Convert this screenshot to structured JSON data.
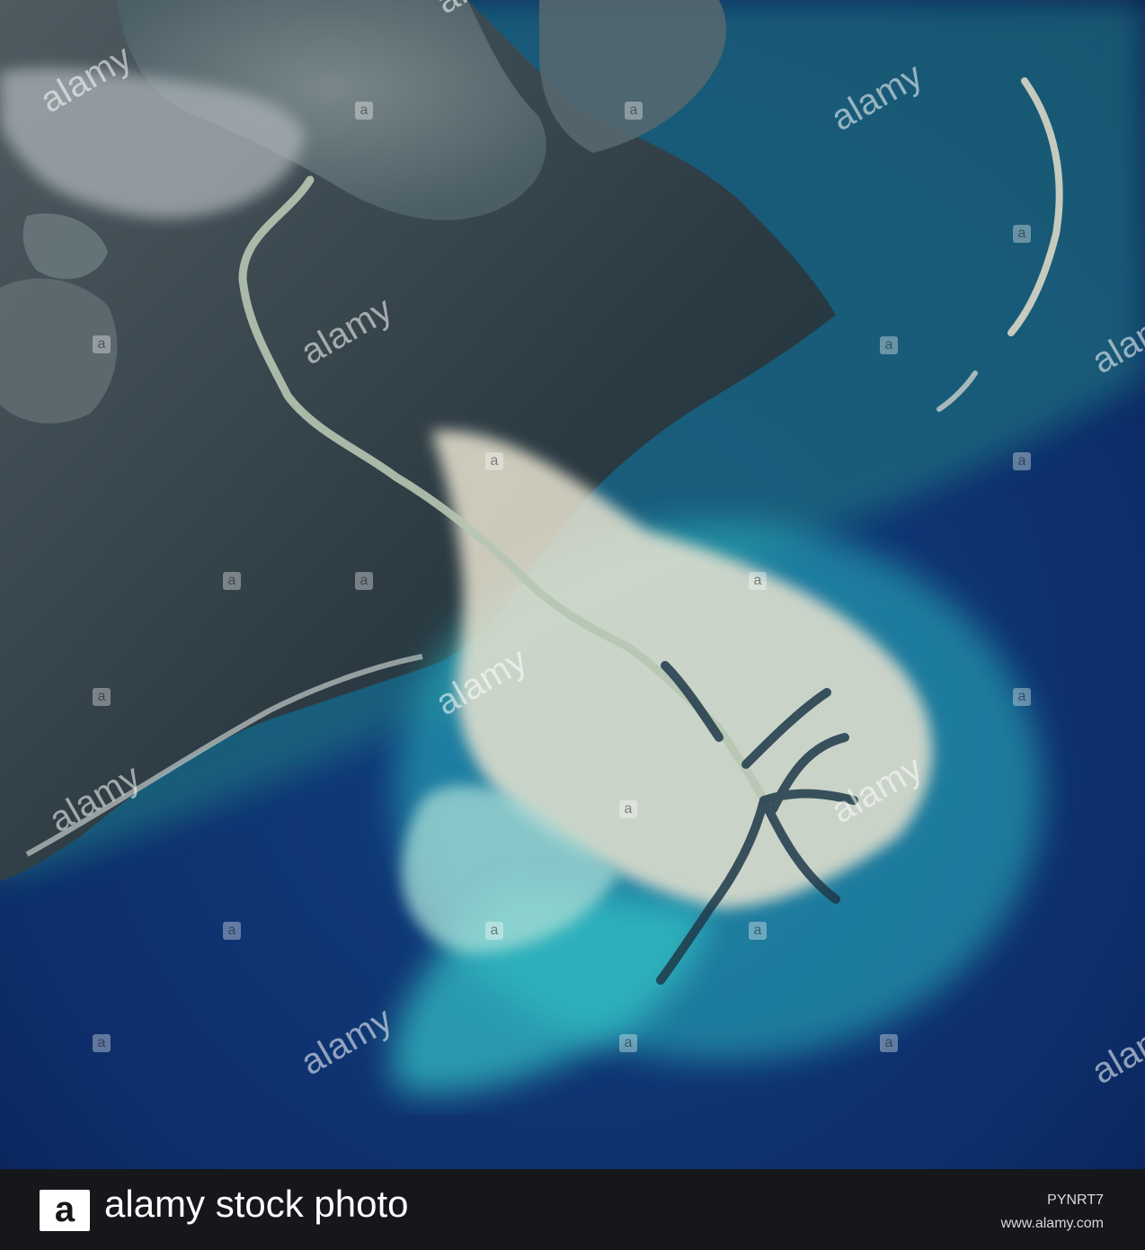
{
  "photo": {
    "subject": "satellite-delta",
    "colors": {
      "ocean_deep": "#0b2760",
      "ocean_mid": "#123f80",
      "teal_plume": "#2fc3c8",
      "sediment": "#e8e3d0",
      "land": "#2b3a42",
      "urban": "#b8bfc4",
      "lake": "#5f6e74"
    }
  },
  "watermark": {
    "text": "alamy",
    "letter": "a"
  },
  "footer": {
    "logo_letter": "a",
    "brand": "alamy stock photo",
    "image_id": "PYNRT7",
    "url": "www.alamy.com"
  }
}
